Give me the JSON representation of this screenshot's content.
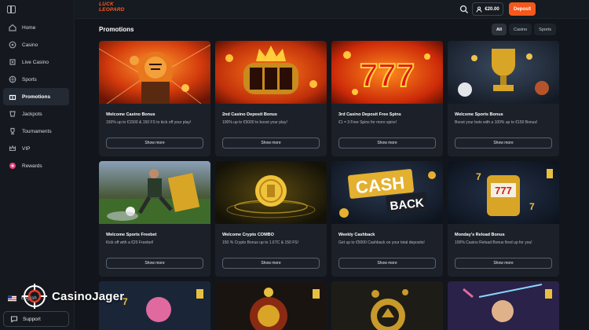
{
  "brand": {
    "logo_line1": "LUCK",
    "logo_line2": "LEOPARD"
  },
  "header": {
    "balance": "€20.00",
    "deposit_label": "Deposit"
  },
  "sidebar": {
    "items": [
      {
        "label": "Home",
        "icon": "home-icon"
      },
      {
        "label": "Casino",
        "icon": "casino-chip-icon"
      },
      {
        "label": "Live Casino",
        "icon": "live-icon"
      },
      {
        "label": "Sports",
        "icon": "ball-icon"
      },
      {
        "label": "Promotions",
        "icon": "gift-icon",
        "active": true
      },
      {
        "label": "Jackpots",
        "icon": "jackpot-icon"
      },
      {
        "label": "Tournaments",
        "icon": "trophy-icon"
      },
      {
        "label": "VIP",
        "icon": "crown-icon"
      },
      {
        "label": "Rewards",
        "icon": "reward-icon"
      }
    ],
    "language": "English",
    "support_label": "Support"
  },
  "main": {
    "title": "Promotions",
    "filters": [
      {
        "label": "All",
        "active": true
      },
      {
        "label": "Casino",
        "active": false
      },
      {
        "label": "Sports",
        "active": false
      }
    ],
    "show_more_label": "Show more",
    "promos": [
      {
        "title": "Welcome Casino Bonus",
        "desc": "150% up to €1500 & 150 FS to kick off your play!",
        "art": "tiger-art"
      },
      {
        "title": "2nd Casino Deposit Bonus",
        "desc": "100% up to €5000 to boost your play!",
        "art": "slot-crown-art"
      },
      {
        "title": "3rd Casino Deposit Free Spins",
        "desc": "€1 = 3 Free Spins for more spins!",
        "art": "777-art"
      },
      {
        "title": "Welcome Sports Bonus",
        "desc": "Boost your bets with a 100% up to €150 Bonus!",
        "art": "trophy-art"
      },
      {
        "title": "Welcome Sports Freebet",
        "desc": "Kick off with a €20 Freebet!",
        "art": "soccer-art"
      },
      {
        "title": "Welcome Crypto COMBO",
        "desc": "150 % Crypto Bonus up to 1.6TC & 150 FS!",
        "art": "crypto-coin-art"
      },
      {
        "title": "Weekly Cashback",
        "desc": "Get up to €5000 Cashback on your total deposits!",
        "art": "cashback-art",
        "art_text1": "CASH",
        "art_text2": "BACK"
      },
      {
        "title": "Monday's Reload Bonus",
        "desc": "100% Casino Reload Bonus fired up for you!",
        "art": "slot-machine-art"
      }
    ]
  },
  "watermark": {
    "text": "CasinoJager"
  },
  "colors": {
    "accent": "#f5581a",
    "bg": "#12161c",
    "card": "#1c2129"
  }
}
